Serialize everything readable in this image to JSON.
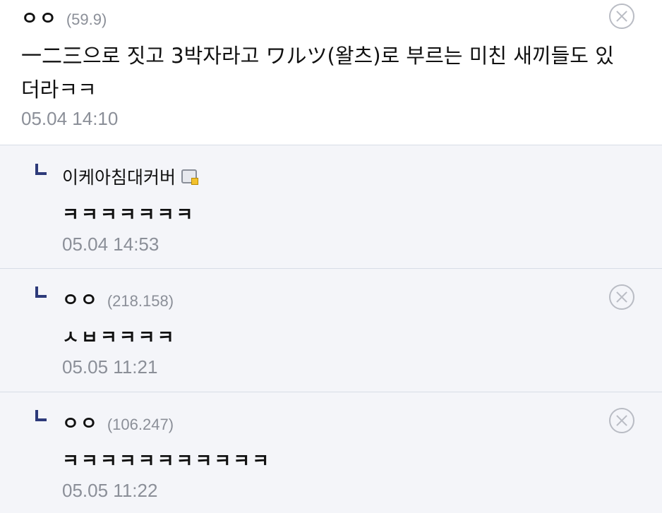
{
  "main_comment": {
    "nickname": "ㅇㅇ",
    "ip": "(59.9)",
    "body": "一二三으로 짓고 3박자라고 ワルツ(왈츠)로 부르는 미친 새끼들도 있더라ㅋㅋ",
    "date": "05.04 14:10"
  },
  "replies": [
    {
      "nickname": "이케아침대커버",
      "ip": "",
      "body": "ㅋㅋㅋㅋㅋㅋㅋ",
      "date": "05.04 14:53",
      "badge_icon": "member-badge-icon",
      "deletable": false
    },
    {
      "nickname": "ㅇㅇ",
      "ip": "(218.158)",
      "body": "ㅅㅂㅋㅋㅋㅋ",
      "date": "05.05 11:21",
      "deletable": true
    },
    {
      "nickname": "ㅇㅇ",
      "ip": "(106.247)",
      "body": "ㅋㅋㅋㅋㅋㅋㅋㅋㅋㅋㅋ",
      "date": "05.05 11:22",
      "deletable": true
    }
  ],
  "colors": {
    "reply_background": "#f4f5f9",
    "reply_arrow": "#2d3a7a",
    "meta_text": "#8b8f98",
    "divider": "#d8dde6"
  },
  "icons": {
    "delete": "close-circle-icon",
    "reply_indicator": "reply-arrow-icon"
  }
}
